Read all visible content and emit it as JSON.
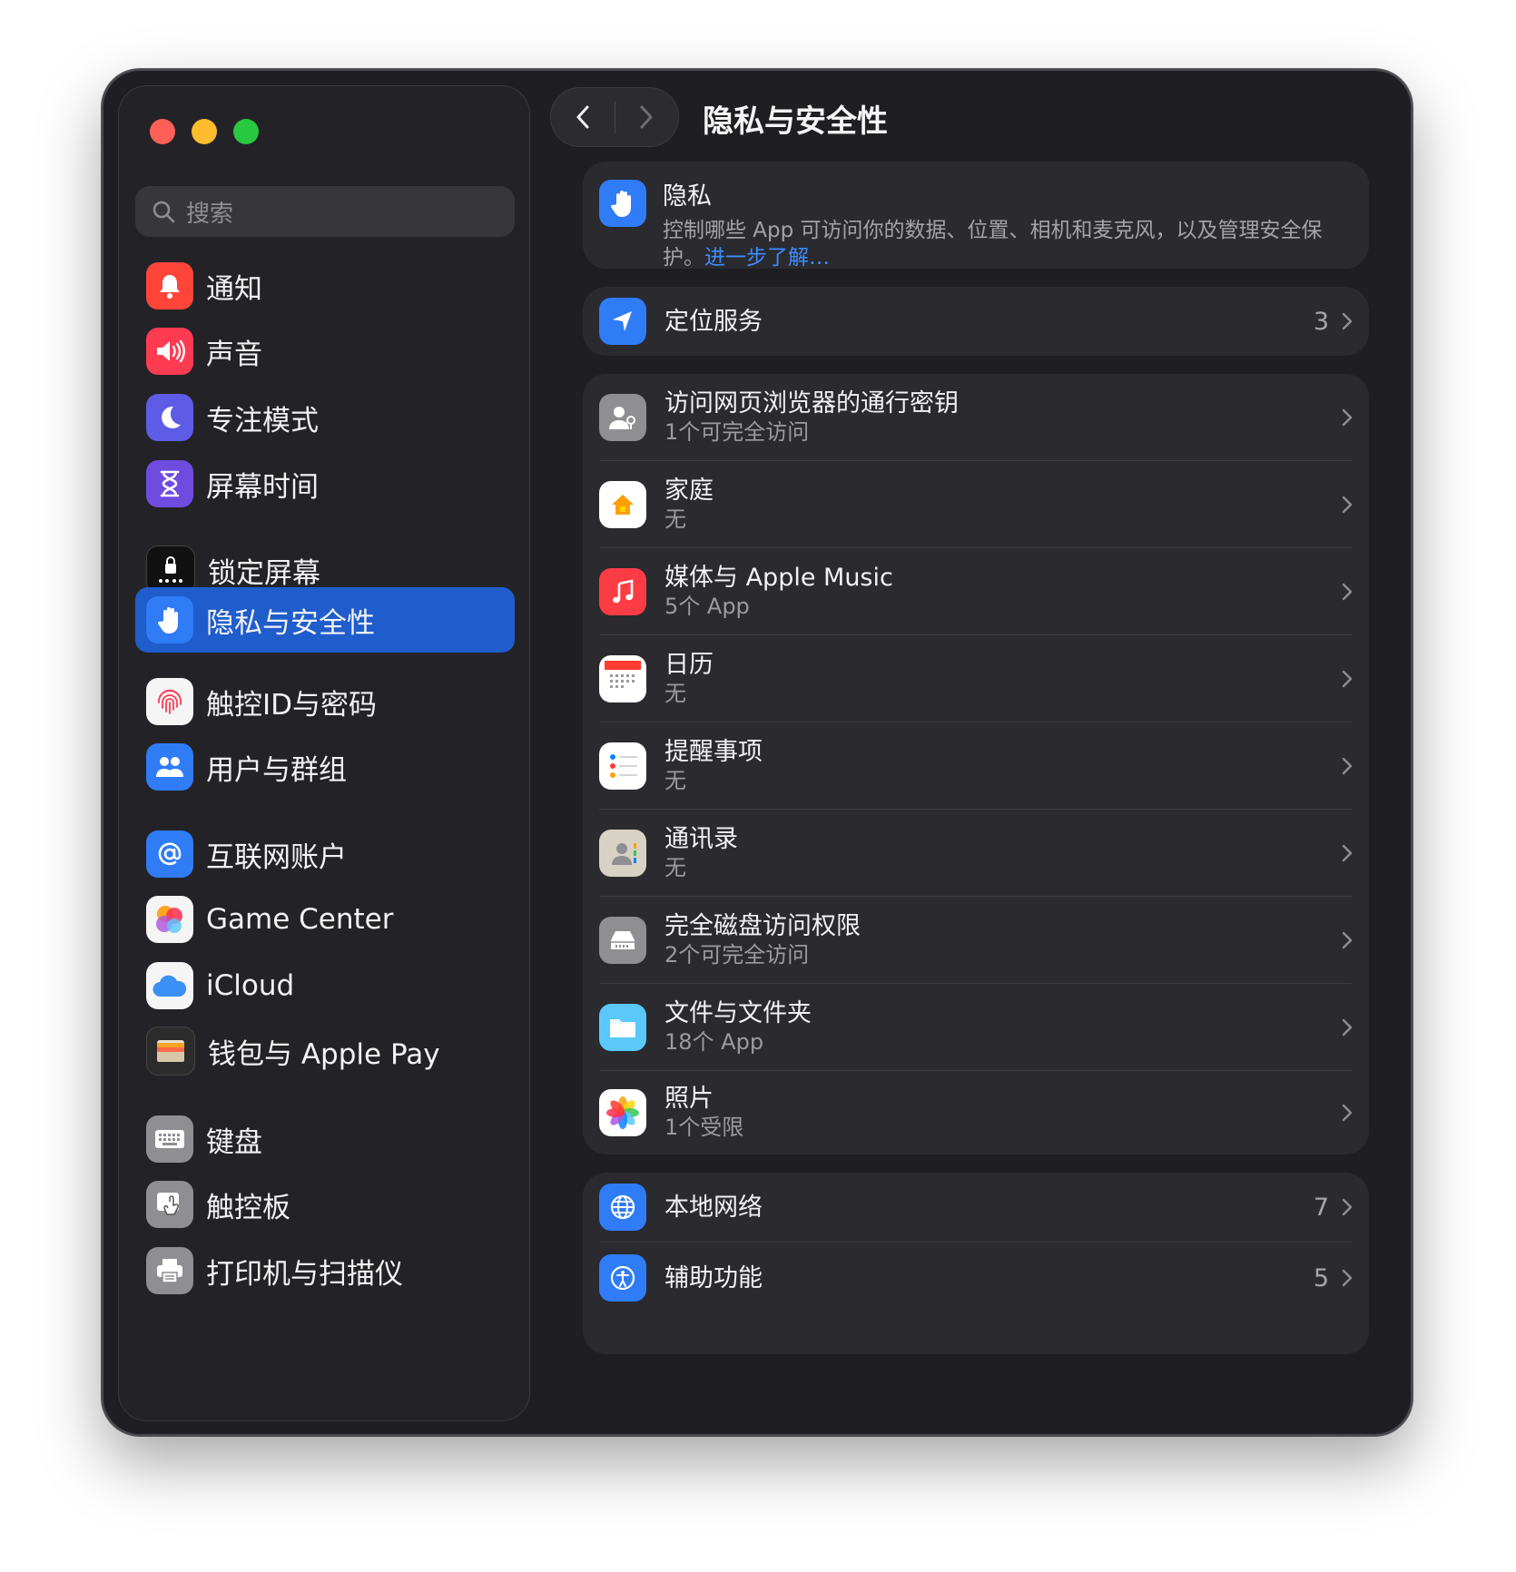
{
  "sidebar": {
    "search_placeholder": "搜索",
    "items": [
      {
        "label": "通知",
        "icon": "bell-icon",
        "color": "#ff453a"
      },
      {
        "label": "声音",
        "icon": "speaker-icon",
        "color": "#ff3b52"
      },
      {
        "label": "专注模式",
        "icon": "moon-icon",
        "color": "#5e5ce6"
      },
      {
        "label": "屏幕时间",
        "icon": "hourglass-icon",
        "color": "#6e4ce0"
      },
      {
        "label": "锁定屏幕",
        "icon": "lock-icon",
        "color": "#111111"
      },
      {
        "label": "隐私与安全性",
        "icon": "hand-icon",
        "color": "#2f7cf6",
        "selected": true
      },
      {
        "label": "触控ID与密码",
        "icon": "fingerprint-icon",
        "color": "#f5f5f5"
      },
      {
        "label": "用户与群组",
        "icon": "users-icon",
        "color": "#2f7cf6"
      },
      {
        "label": "互联网账户",
        "icon": "at-icon",
        "color": "#2f7cf6"
      },
      {
        "label": "Game Center",
        "icon": "game-center-icon",
        "color": "#f5f5f5"
      },
      {
        "label": "iCloud",
        "icon": "cloud-icon",
        "color": "#f5f5f5"
      },
      {
        "label": "钱包与 Apple Pay",
        "icon": "wallet-icon",
        "color": "#2c2c2c"
      },
      {
        "label": "键盘",
        "icon": "keyboard-icon",
        "color": "#8e8e93"
      },
      {
        "label": "触控板",
        "icon": "trackpad-icon",
        "color": "#8e8e93"
      },
      {
        "label": "打印机与扫描仪",
        "icon": "printer-icon",
        "color": "#8e8e93"
      }
    ]
  },
  "header": {
    "title": "隐私与安全性"
  },
  "privacy_card": {
    "title": "隐私",
    "description": "控制哪些 App 可访问你的数据、位置、相机和麦克风，以及管理安全保护。",
    "link_line1": "进一",
    "link_line2": "步了解…"
  },
  "location": {
    "title": "定位服务",
    "value": "3"
  },
  "permissions": [
    {
      "title": "访问网页浏览器的通行密钥",
      "subtitle": "1个可完全访问",
      "icon": "passkey-icon"
    },
    {
      "title": "家庭",
      "subtitle": "无",
      "icon": "home-icon"
    },
    {
      "title": "媒体与 Apple Music",
      "subtitle": "5个 App",
      "icon": "music-icon"
    },
    {
      "title": "日历",
      "subtitle": "无",
      "icon": "calendar-icon"
    },
    {
      "title": "提醒事项",
      "subtitle": "无",
      "icon": "reminders-icon"
    },
    {
      "title": "通讯录",
      "subtitle": "无",
      "icon": "contacts-icon"
    },
    {
      "title": "完全磁盘访问权限",
      "subtitle": "2个可完全访问",
      "icon": "disk-icon"
    },
    {
      "title": "文件与文件夹",
      "subtitle": "18个 App",
      "icon": "folder-icon"
    },
    {
      "title": "照片",
      "subtitle": "1个受限",
      "icon": "photos-icon"
    }
  ],
  "network": [
    {
      "title": "本地网络",
      "value": "7",
      "icon": "globe-icon"
    },
    {
      "title": "辅助功能",
      "value": "5",
      "icon": "accessibility-icon"
    }
  ],
  "colors": {
    "accent": "#1f5ccc",
    "link": "#3c8cff",
    "window_bg": "#1f1f23"
  }
}
